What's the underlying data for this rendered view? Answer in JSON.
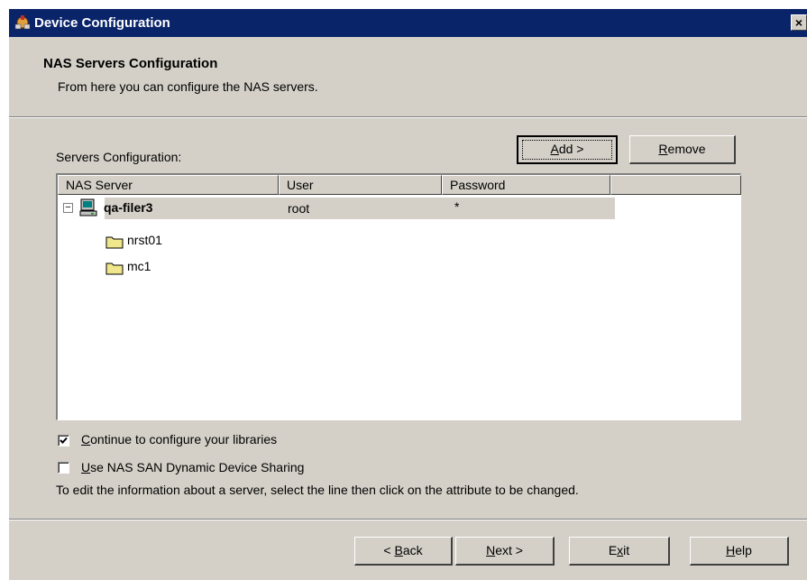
{
  "window": {
    "title": "Device Configuration",
    "close_glyph": "×"
  },
  "header": {
    "title": "NAS Servers Configuration",
    "subtitle": "From here you can configure the NAS servers."
  },
  "servers_section": {
    "label": "Servers Configuration:",
    "add_button": {
      "mnemonic": "A",
      "rest": "dd >"
    },
    "remove_button": {
      "mnemonic": "R",
      "rest": "emove"
    }
  },
  "table": {
    "columns": [
      "NAS Server",
      "User",
      "Password"
    ],
    "server": {
      "name": "qa-filer3",
      "user": "root",
      "password": "*",
      "expanded": true,
      "toggle": "−"
    },
    "children": [
      "nrst01",
      "mc1"
    ]
  },
  "options": {
    "continue_libraries": {
      "mnemonic": "C",
      "rest": "ontinue to configure your libraries",
      "checked": true
    },
    "san_sharing": {
      "mnemonic": "U",
      "rest": "se NAS SAN Dynamic Device Sharing",
      "checked": false
    },
    "hint": "To edit the information about a server, select the line then click on the attribute to be changed."
  },
  "footer": {
    "back": {
      "pre": "< ",
      "mnemonic": "B",
      "rest": "ack"
    },
    "next": {
      "mnemonic": "N",
      "rest": "ext >"
    },
    "exit": {
      "pre": "E",
      "mnemonic": "x",
      "rest": "it"
    },
    "help": {
      "mnemonic": "H",
      "rest": "elp"
    }
  },
  "colors": {
    "titlebar": "#0a246a",
    "dialog_face": "#d4d0c8",
    "selection": "#d4d0c8",
    "folder": "#f0e68c"
  },
  "icons": {
    "title": "device-config-icon",
    "server": "computer-icon",
    "child": "folder-icon"
  }
}
